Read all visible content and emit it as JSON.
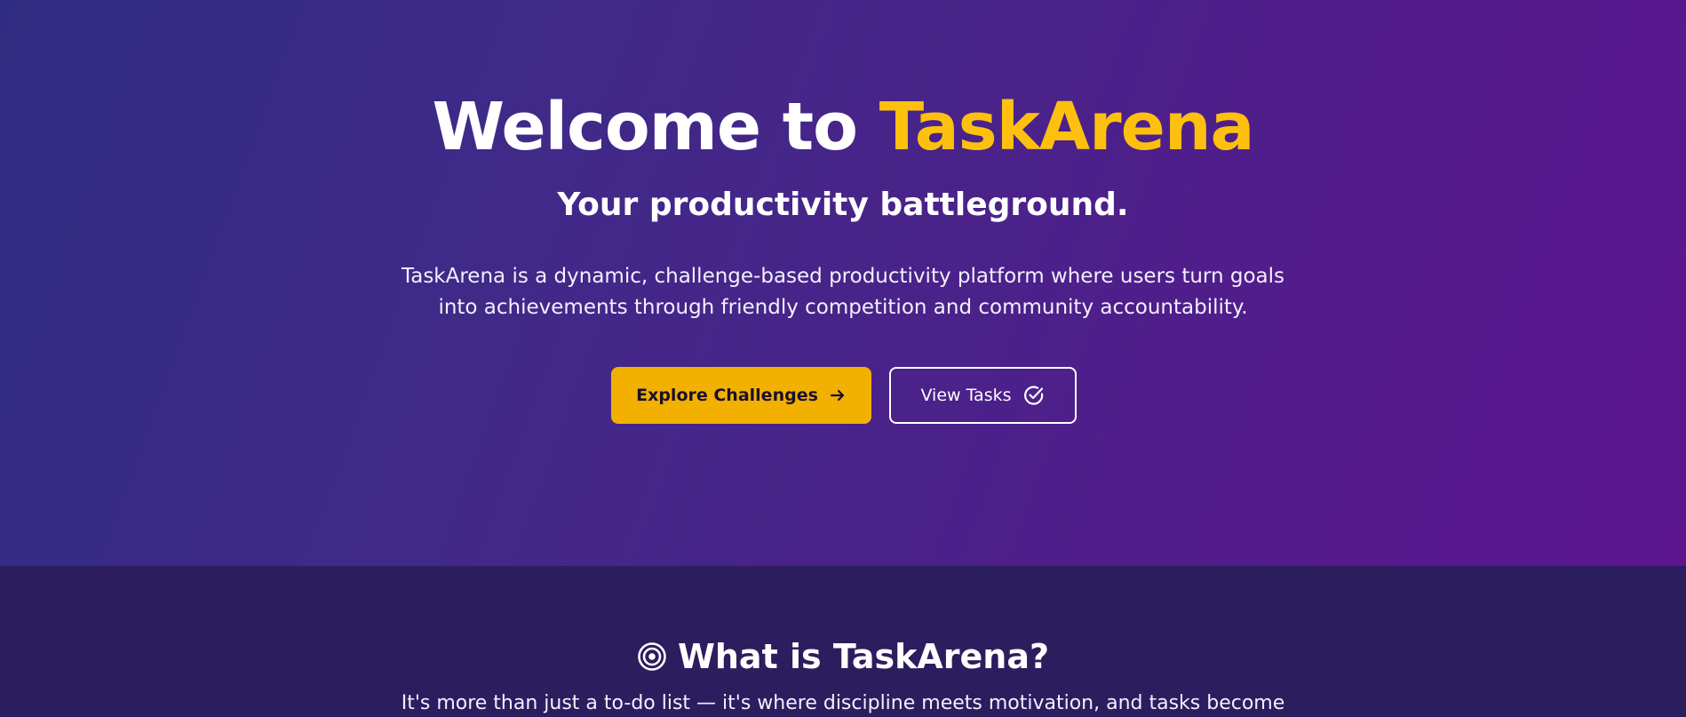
{
  "hero": {
    "title_prefix": "Welcome to ",
    "title_brand": "TaskArena",
    "subtitle": "Your productivity battleground.",
    "description": "TaskArena is a dynamic, challenge-based productivity platform where users turn goals into achievements through friendly competition and community accountability.",
    "primary_button_label": "Explore Challenges",
    "primary_button_icon": "arrow-right-icon",
    "secondary_button_label": "View Tasks",
    "secondary_button_icon": "check-circle-icon"
  },
  "about": {
    "title": "What is TaskArena?",
    "title_icon": "target-icon",
    "description": "It's more than just a to-do list — it's where discipline meets motivation, and tasks become"
  },
  "colors": {
    "brand_accent": "#fdc00f",
    "primary_button": "#f2b000",
    "hero_gradient_start": "#312c83",
    "hero_gradient_end": "#5c158f",
    "section_bg": "#2c1d5e"
  }
}
